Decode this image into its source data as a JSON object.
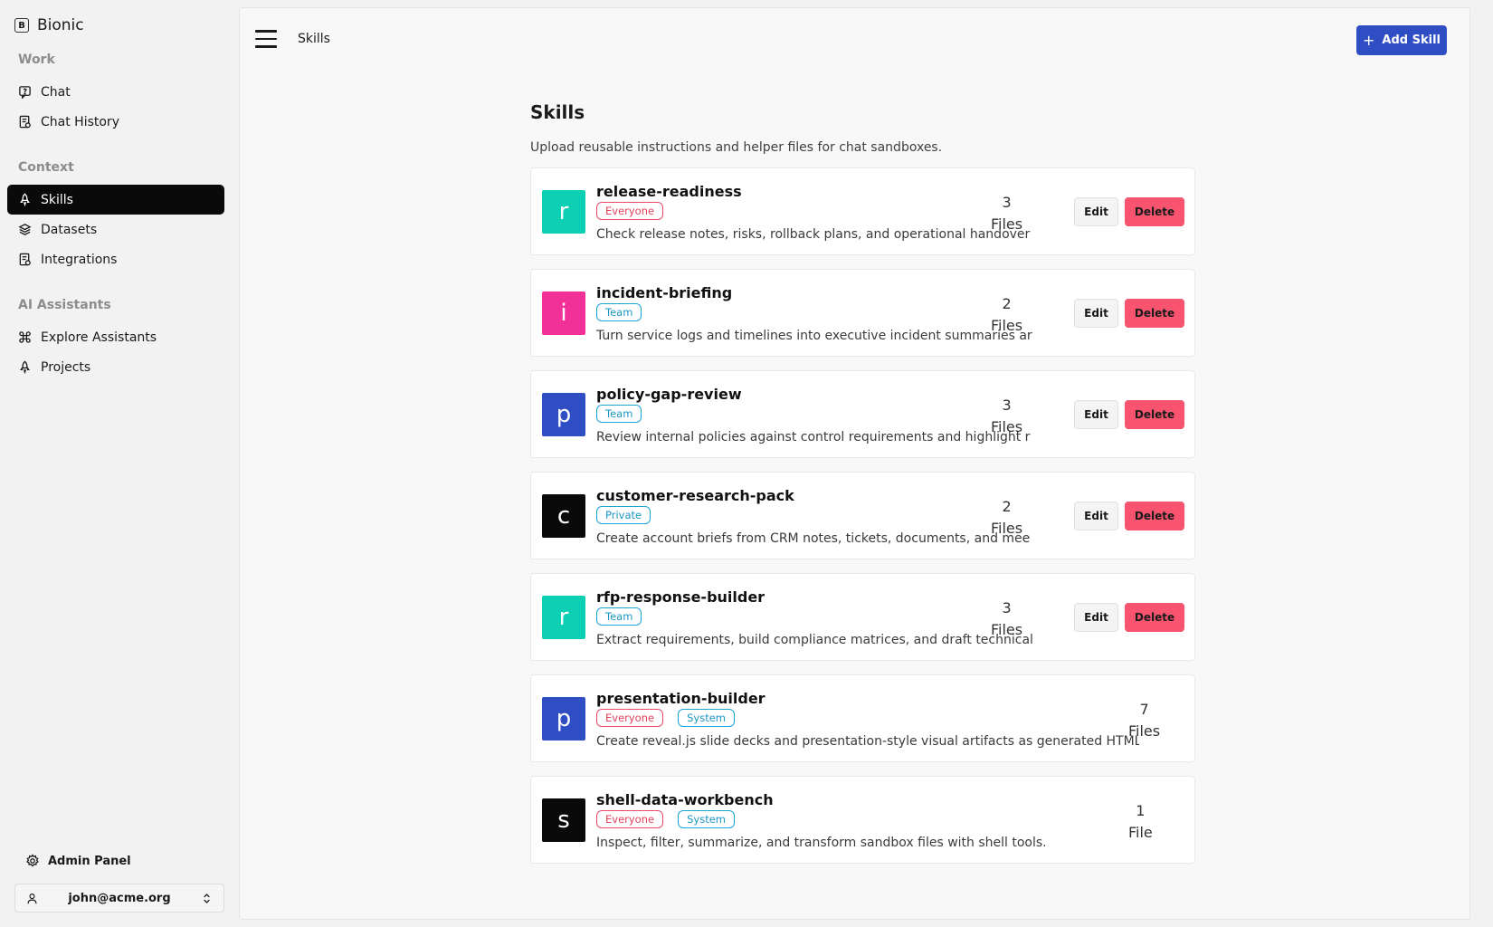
{
  "brand": {
    "icon_letter": "B",
    "name": "Bionic"
  },
  "sidebar": {
    "sections": [
      {
        "label": "Work",
        "items": [
          {
            "label": "Chat",
            "icon": "chat-icon"
          },
          {
            "label": "Chat History",
            "icon": "history-icon"
          }
        ]
      },
      {
        "label": "Context",
        "items": [
          {
            "label": "Skills",
            "icon": "rocket-icon",
            "active": true
          },
          {
            "label": "Datasets",
            "icon": "layers-icon"
          },
          {
            "label": "Integrations",
            "icon": "integrations-icon"
          }
        ]
      },
      {
        "label": "AI Assistants",
        "items": [
          {
            "label": "Explore Assistants",
            "icon": "command-icon"
          },
          {
            "label": "Projects",
            "icon": "rocket-icon"
          }
        ]
      }
    ],
    "admin_label": "Admin Panel",
    "user_email": "john@acme.org"
  },
  "header": {
    "breadcrumb": "Skills",
    "add_button": "Add Skill"
  },
  "page": {
    "title": "Skills",
    "subtitle": "Upload reusable instructions and helper files for chat sandboxes."
  },
  "skills": [
    {
      "letter": "r",
      "color": "#0ccfb4",
      "name": "release-readiness",
      "badges": [
        "Everyone"
      ],
      "description": "Check release notes, risks, rollback plans, and operational handover",
      "file_count": "3",
      "file_label": "Files",
      "editable": true
    },
    {
      "letter": "i",
      "color": "#f23198",
      "name": "incident-briefing",
      "badges": [
        "Team"
      ],
      "description": "Turn service logs and timelines into executive incident summaries ar",
      "file_count": "2",
      "file_label": "Files",
      "editable": true
    },
    {
      "letter": "p",
      "color": "#2f4ec4",
      "name": "policy-gap-review",
      "badges": [
        "Team"
      ],
      "description": "Review internal policies against control requirements and highlight r",
      "file_count": "3",
      "file_label": "Files",
      "editable": true
    },
    {
      "letter": "c",
      "color": "#0a0a0a",
      "name": "customer-research-pack",
      "badges": [
        "Private"
      ],
      "description": "Create account briefs from CRM notes, tickets, documents, and mee",
      "file_count": "2",
      "file_label": "Files",
      "editable": true
    },
    {
      "letter": "r",
      "color": "#0ccfb4",
      "name": "rfp-response-builder",
      "badges": [
        "Team"
      ],
      "description": "Extract requirements, build compliance matrices, and draft technical",
      "file_count": "3",
      "file_label": "Files",
      "editable": true
    },
    {
      "letter": "p",
      "color": "#2f4ec4",
      "name": "presentation-builder",
      "badges": [
        "Everyone",
        "System"
      ],
      "description": "Create reveal.js slide decks and presentation-style visual artifacts as generated HTML canvas",
      "file_count": "7",
      "file_label": "Files",
      "editable": false
    },
    {
      "letter": "s",
      "color": "#0a0a0a",
      "name": "shell-data-workbench",
      "badges": [
        "Everyone",
        "System"
      ],
      "description": "Inspect, filter, summarize, and transform sandbox files with shell tools.",
      "file_count": "1",
      "file_label": "File",
      "editable": false
    }
  ],
  "actions": {
    "edit_label": "Edit",
    "delete_label": "Delete"
  }
}
